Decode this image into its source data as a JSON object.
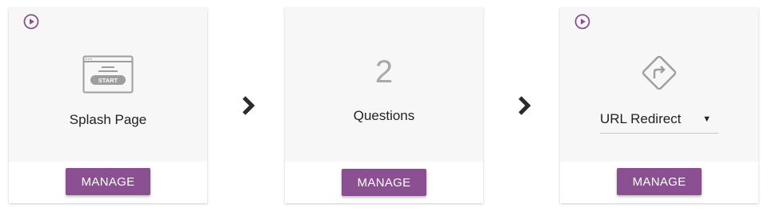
{
  "steps": [
    {
      "type": "splash",
      "title": "Splash Page",
      "icon": "splash-start-icon",
      "icon_text": "START",
      "has_play": true,
      "manage_label": "MANAGE"
    },
    {
      "type": "questions",
      "count": "2",
      "title": "Questions",
      "has_play": false,
      "manage_label": "MANAGE"
    },
    {
      "type": "redirect",
      "icon": "redirect-sign-icon",
      "select_value": "URL Redirect",
      "caret": "▼",
      "has_play": true,
      "manage_label": "MANAGE"
    }
  ],
  "colors": {
    "accent": "#8b5091",
    "card_top": "#f7f7f7",
    "icon_gray": "#9e9e9e",
    "count_gray": "#a9a9a9",
    "chevron": "#2b2b2b"
  }
}
